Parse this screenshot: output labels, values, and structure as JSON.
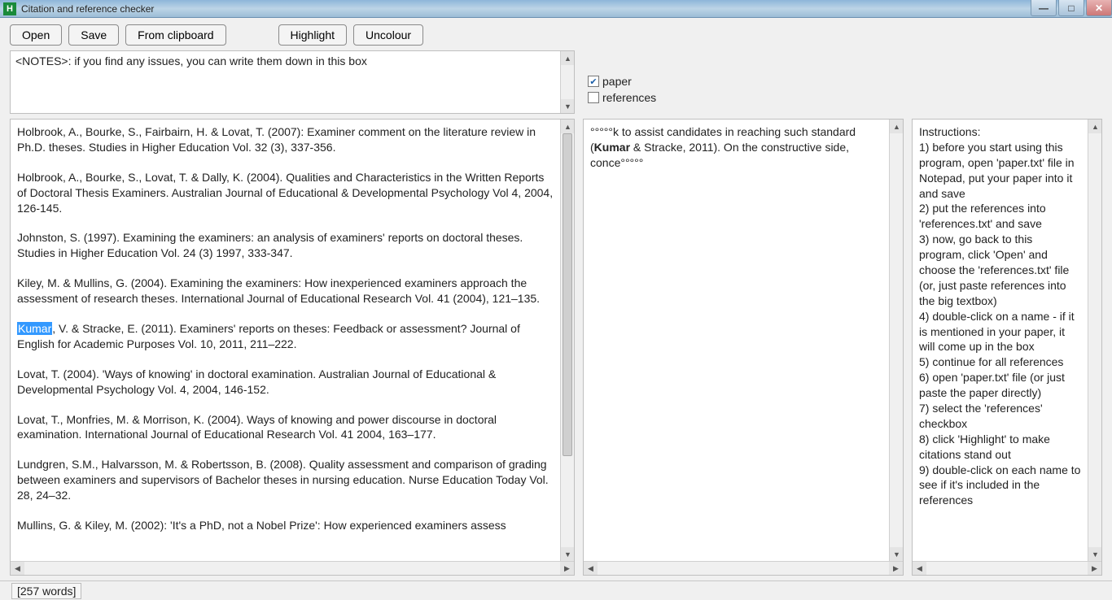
{
  "window": {
    "title": "Citation and reference checker",
    "icon_letter": "H"
  },
  "toolbar": {
    "open": "Open",
    "save": "Save",
    "from_clipboard": "From clipboard",
    "highlight": "Highlight",
    "uncolour": "Uncolour"
  },
  "notes": {
    "text": "<NOTES>: if you find any issues, you can write them down in this box"
  },
  "checkboxes": {
    "paper": {
      "label": "paper",
      "checked": true
    },
    "references": {
      "label": "references",
      "checked": false
    }
  },
  "references": [
    "Holbrook, A., Bourke, S., Fairbairn, H. & Lovat, T. (2007): Examiner comment on the literature review in Ph.D. theses. Studies in Higher Education Vol. 32 (3), 337-356.",
    "Holbrook, A., Bourke, S., Lovat, T. & Dally, K. (2004). Qualities and Characteristics in the Written Reports of Doctoral Thesis Examiners. Australian Journal of Educational & Developmental Psychology Vol 4, 2004, 126-145.",
    "Johnston, S. (1997). Examining the examiners: an analysis of examiners' reports on doctoral theses. Studies in Higher Education Vol. 24 (3) 1997, 333-347.",
    "Kiley, M. & Mullins, G. (2004). Examining the examiners: How inexperienced examiners approach the assessment of research theses. International Journal of Educational Research Vol. 41 (2004), 121–135.",
    ", V. & Stracke, E. (2011). Examiners' reports on theses: Feedback or assessment? Journal of English for Academic Purposes Vol. 10, 2011, 211–222.",
    "Lovat, T. (2004). 'Ways of knowing' in doctoral examination. Australian Journal of Educational & Developmental Psychology Vol. 4, 2004, 146-152.",
    "Lovat, T., Monfries, M. & Morrison, K. (2004). Ways of knowing and power discourse in doctoral examination. International Journal of Educational Research Vol. 41 2004, 163–177.",
    "Lundgren, S.M., Halvarsson, M. & Robertsson, B. (2008). Quality assessment and comparison of grading between examiners and supervisors of Bachelor theses in nursing education. Nurse Education Today Vol. 28, 24–32.",
    "Mullins, G. & Kiley, M. (2002): 'It's a PhD, not a Nobel Prize': How experienced examiners assess"
  ],
  "selected_word": "Kumar",
  "snippet": {
    "pre": "°°°°°k to assist candidates in reaching such standard (",
    "bold": "Kumar",
    "post": " & Stracke, 2011). On the constructive side, conce°°°°°"
  },
  "instructions": {
    "heading": "Instructions:",
    "lines": [
      "1) before you start using this program, open 'paper.txt' file in Notepad, put your paper into it and save",
      "2) put the references into 'references.txt' and save",
      "3) now, go back to this program, click 'Open' and choose the 'references.txt' file (or, just paste references into the big textbox)",
      "4) double-click on a name - if it is mentioned in your paper, it will come up in the box",
      "5) continue for all references",
      "6) open 'paper.txt' file (or just paste the paper directly)",
      "7) select the 'references' checkbox",
      "8) click 'Highlight' to make citations stand out",
      "9) double-click on each name to see if it's included in the references"
    ]
  },
  "status": {
    "word_count_label": "[257 words]"
  }
}
